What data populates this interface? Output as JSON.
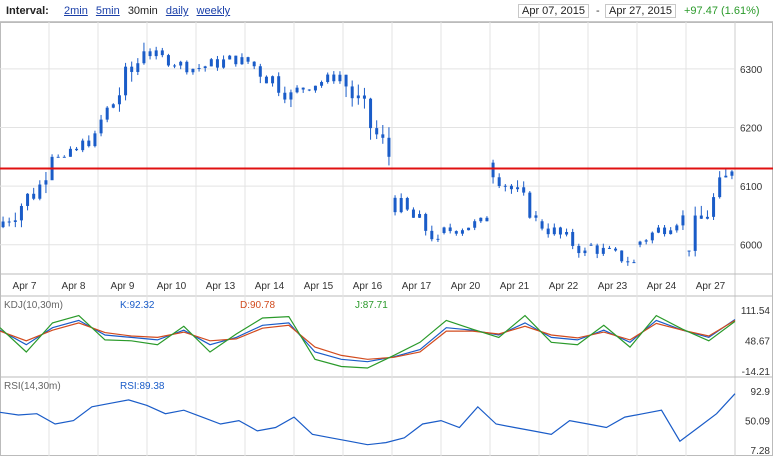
{
  "toolbar": {
    "interval_label": "Interval:",
    "options": [
      {
        "label": "2min",
        "link": true
      },
      {
        "label": "5min",
        "link": true
      },
      {
        "label": "30min",
        "link": false
      },
      {
        "label": "daily",
        "link": true
      },
      {
        "label": "weekly",
        "link": true
      }
    ],
    "date_from": "Apr 07, 2015",
    "date_sep": "-",
    "date_to": "Apr 27, 2015",
    "change": "+97.47 (1.61%)"
  },
  "chart_data": [
    {
      "type": "line",
      "panel": "price",
      "style": "candlestick",
      "x_labels": [
        "Apr 7",
        "Apr 8",
        "Apr 9",
        "Apr 10",
        "Apr 13",
        "Apr 14",
        "Apr 15",
        "Apr 16",
        "Apr 17",
        "Apr 20",
        "Apr 21",
        "Apr 22",
        "Apr 23",
        "Apr 24",
        "Apr 27"
      ],
      "y_ticks": [
        6000,
        6100,
        6200,
        6300
      ],
      "ylim": [
        5950,
        6380
      ],
      "reference_line": 6130,
      "daily": [
        {
          "day": "Apr 7",
          "open": 6030,
          "close": 6110,
          "high": 6145,
          "low": 6020
        },
        {
          "day": "Apr 8",
          "open": 6110,
          "close": 6190,
          "high": 6230,
          "low": 6150
        },
        {
          "day": "Apr 9",
          "open": 6190,
          "close": 6330,
          "high": 6350,
          "low": 6185
        },
        {
          "day": "Apr 10",
          "open": 6330,
          "close": 6300,
          "high": 6345,
          "low": 6290
        },
        {
          "day": "Apr 13",
          "open": 6300,
          "close": 6320,
          "high": 6345,
          "low": 6280
        },
        {
          "day": "Apr 14",
          "open": 6320,
          "close": 6260,
          "high": 6330,
          "low": 6215
        },
        {
          "day": "Apr 15",
          "open": 6260,
          "close": 6290,
          "high": 6305,
          "low": 6250
        },
        {
          "day": "Apr 16",
          "open": 6290,
          "close": 6150,
          "high": 6290,
          "low": 6120
        },
        {
          "day": "Apr 17",
          "open": 6080,
          "close": 6010,
          "high": 6090,
          "low": 5990
        },
        {
          "day": "Apr 20",
          "open": 6020,
          "close": 6040,
          "high": 6060,
          "low": 6000
        },
        {
          "day": "Apr 21",
          "open": 6140,
          "close": 6050,
          "high": 6145,
          "low": 6040
        },
        {
          "day": "Apr 22",
          "open": 6040,
          "close": 5990,
          "high": 6050,
          "low": 5970
        },
        {
          "day": "Apr 23",
          "open": 6000,
          "close": 5970,
          "high": 6020,
          "low": 5955
        },
        {
          "day": "Apr 24",
          "open": 6000,
          "close": 6050,
          "high": 6070,
          "low": 5995
        },
        {
          "day": "Apr 27",
          "open": 5990,
          "close": 6125,
          "high": 6130,
          "low": 5980
        }
      ]
    },
    {
      "type": "line",
      "panel": "kdj",
      "label": "KDJ(10,30m)",
      "y_ticks": [
        111.54,
        48.67,
        -14.21
      ],
      "ylim": [
        -14.21,
        111.54
      ],
      "series": [
        {
          "name": "K:92.32",
          "color": "#1a5cc8",
          "values": [
            70,
            40,
            75,
            90,
            60,
            55,
            50,
            70,
            40,
            55,
            80,
            85,
            25,
            10,
            5,
            15,
            30,
            75,
            70,
            60,
            85,
            55,
            50,
            70,
            45,
            90,
            70,
            55,
            92
          ]
        },
        {
          "name": "D:90.78",
          "color": "#d24b1e",
          "values": [
            68,
            48,
            70,
            85,
            65,
            58,
            55,
            66,
            48,
            52,
            74,
            80,
            35,
            18,
            10,
            14,
            25,
            68,
            68,
            62,
            78,
            60,
            54,
            66,
            50,
            84,
            70,
            58,
            90
          ]
        },
        {
          "name": "J:87.71",
          "color": "#2a9a2a",
          "values": [
            75,
            25,
            85,
            100,
            50,
            48,
            40,
            78,
            25,
            62,
            95,
            98,
            10,
            -5,
            -8,
            18,
            45,
            90,
            72,
            55,
            100,
            45,
            40,
            80,
            35,
            100,
            72,
            48,
            88
          ]
        }
      ]
    },
    {
      "type": "line",
      "panel": "rsi",
      "label": "RSI(14,30m)",
      "y_ticks": [
        92.9,
        50.09,
        7.28
      ],
      "ylim": [
        7.28,
        92.9
      ],
      "series": [
        {
          "name": "RSI:89.38",
          "color": "#1a5cc8",
          "values": [
            62,
            58,
            60,
            45,
            50,
            70,
            75,
            80,
            72,
            60,
            65,
            55,
            45,
            50,
            35,
            40,
            55,
            30,
            25,
            20,
            15,
            18,
            25,
            45,
            50,
            40,
            70,
            45,
            40,
            35,
            30,
            50,
            45,
            40,
            55,
            60,
            65,
            20,
            40,
            60,
            89
          ]
        }
      ]
    }
  ]
}
